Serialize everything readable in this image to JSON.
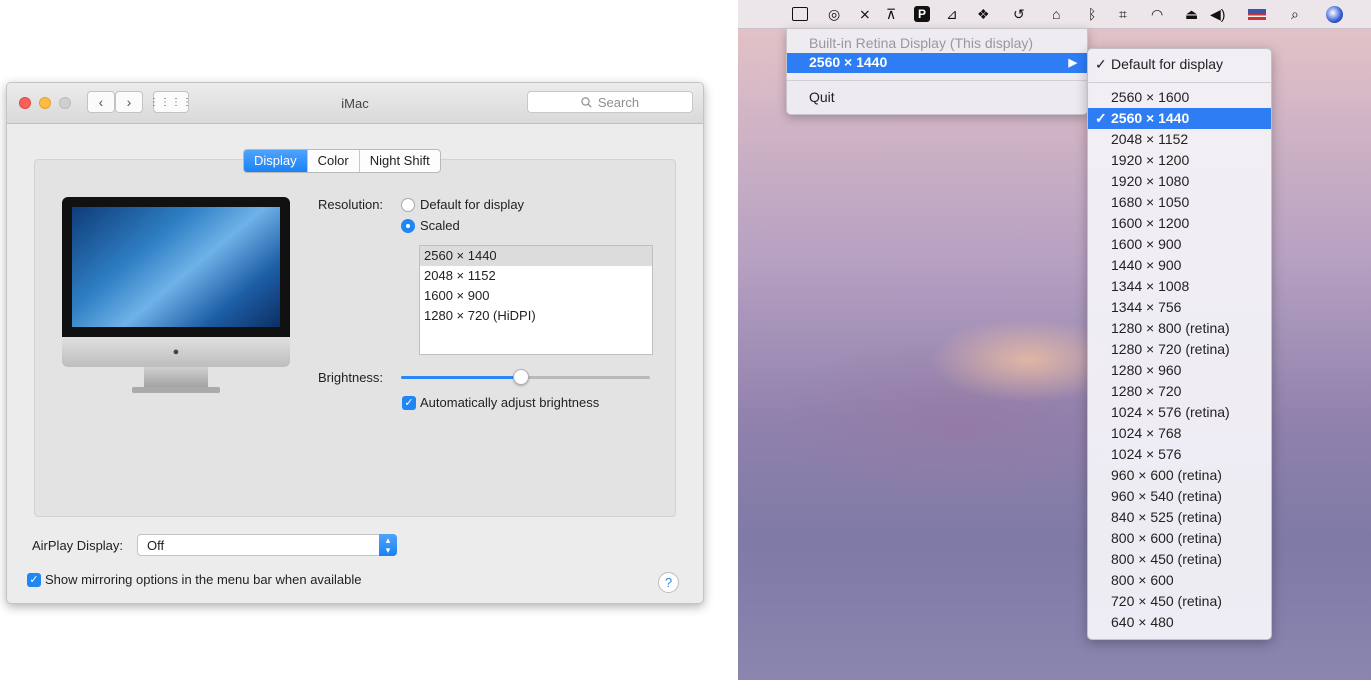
{
  "prefs_window": {
    "title": "iMac",
    "search_placeholder": "Search",
    "tabs": [
      "Display",
      "Color",
      "Night Shift"
    ],
    "active_tab": "Display",
    "resolution_label": "Resolution:",
    "resolution_options": [
      "Default for display",
      "Scaled"
    ],
    "selected_resolution_option": "Scaled",
    "scaled_list": [
      "2560 × 1440",
      "2048 × 1152",
      "1600 × 900",
      "1280 × 720 (HiDPI)"
    ],
    "scaled_selected": "2560 × 1440",
    "brightness_label": "Brightness:",
    "brightness_level": 0.48,
    "auto_brightness_label": "Automatically adjust brightness",
    "auto_brightness_checked": true,
    "airplay_label": "AirPlay Display:",
    "airplay_value": "Off",
    "mirroring_label": "Show mirroring options in the menu bar when available",
    "mirroring_checked": true,
    "help_label": "?"
  },
  "menubar": {
    "icons": [
      "display-icon",
      "creative-cloud-icon",
      "crossed-tools-icon",
      "arrow-up-bar-icon",
      "p-app-icon",
      "airplay-icon",
      "dropbox-icon",
      "time-machine-icon",
      "house-icon",
      "bluetooth-icon",
      "crop-icon",
      "wifi-icon",
      "eject-icon",
      "volume-icon",
      "flag-icon",
      "spotlight-icon",
      "siri-icon"
    ]
  },
  "display_menu": {
    "header": "Built-in Retina Display (This display)",
    "current": "2560 × 1440",
    "quit": "Quit"
  },
  "resolution_submenu": {
    "default_item": "Default for display",
    "checkmark": "✓",
    "selected": "2560 × 1440",
    "items": [
      "2560 × 1600",
      "2560 × 1440",
      "2048 × 1152",
      "1920 × 1200",
      "1920 × 1080",
      "1680 × 1050",
      "1600 × 1200",
      "1600 × 900",
      "1440 × 900",
      "1344 × 1008",
      "1344 × 756",
      "1280 × 800 (retina)",
      "1280 × 720 (retina)",
      "1280 × 960",
      "1280 × 720",
      "1024 × 576 (retina)",
      "1024 × 768",
      "1024 × 576",
      "960 × 600 (retina)",
      "960 × 540 (retina)",
      "840 × 525 (retina)",
      "800 × 600 (retina)",
      "800 × 450 (retina)",
      "800 × 600",
      "720 × 450 (retina)",
      "640 × 480"
    ]
  },
  "colors": {
    "accent": "#1f86f5",
    "menu_highlight": "#2e7df5"
  }
}
